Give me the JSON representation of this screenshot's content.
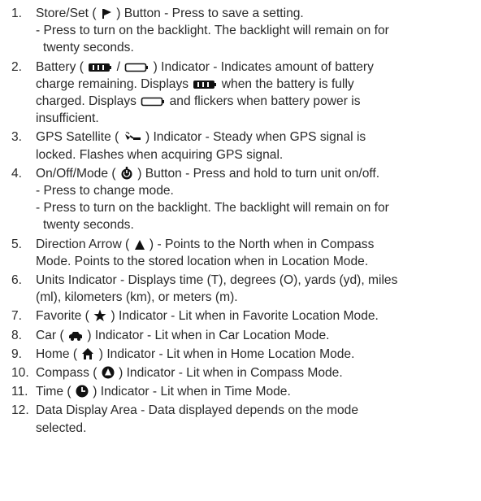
{
  "items": [
    {
      "num": "1.",
      "line1_a": "Store/Set ( ",
      "icon": "flag-icon",
      "line1_b": " ) Button - Press to save a setting.",
      "sub1": "- Press to turn on the backlight. The backlight will remain on for",
      "sub1_cont": "twenty seconds."
    },
    {
      "num": "2.",
      "p1": "Battery ( ",
      "p2": " / ",
      "p3": " ) Indicator - Indicates amount of battery",
      "line2_a": "charge remaining. Displays ",
      "line2_b": " when the battery is fully",
      "line3_a": "charged. Displays ",
      "line3_b": " and flickers when battery power is",
      "line4": "insufficient."
    },
    {
      "num": "3.",
      "p1": "GPS Satellite ( ",
      "icon": "satellite-icon",
      "p2": " ) Indicator - Steady when GPS signal is",
      "line2": "locked. Flashes when acquiring GPS signal."
    },
    {
      "num": "4.",
      "p1": "On/Off/Mode ( ",
      "icon": "power-icon",
      "p2": " ) Button - Press and hold to turn unit on/off.",
      "sub1": "- Press to change mode.",
      "sub2": "- Press to turn on the backlight. The backlight will remain on for",
      "sub2_cont": "twenty seconds."
    },
    {
      "num": "5.",
      "p1": "Direction Arrow ( ",
      "icon": "triangle-up-icon",
      "p2": " ) - Points to the North when in Compass",
      "line2": "Mode. Points to the stored location when in Location Mode."
    },
    {
      "num": "6.",
      "line1": "Units Indicator - Displays time (T), degrees (O), yards (yd), miles",
      "line2": "(ml), kilometers (km), or meters (m)."
    },
    {
      "num": "7.",
      "p1": "Favorite ( ",
      "icon": "star-icon",
      "p2": " ) Indicator - Lit when in Favorite Location Mode."
    },
    {
      "num": "8.",
      "p1": "Car ( ",
      "icon": "car-icon",
      "p2": " ) Indicator - Lit when in Car Location Mode."
    },
    {
      "num": "9.",
      "p1": "Home ( ",
      "icon": "home-icon",
      "p2": " ) Indicator - Lit when in Home Location Mode."
    },
    {
      "num": "10.",
      "p1": "Compass ( ",
      "icon": "compass-icon",
      "p2": " ) Indicator - Lit when in Compass Mode."
    },
    {
      "num": "11.",
      "p1": "Time ( ",
      "icon": "clock-icon",
      "p2": " ) Indicator - Lit when in Time Mode."
    },
    {
      "num": "12.",
      "line1": "Data Display Area - Data displayed depends on the mode",
      "line2": "selected."
    }
  ]
}
